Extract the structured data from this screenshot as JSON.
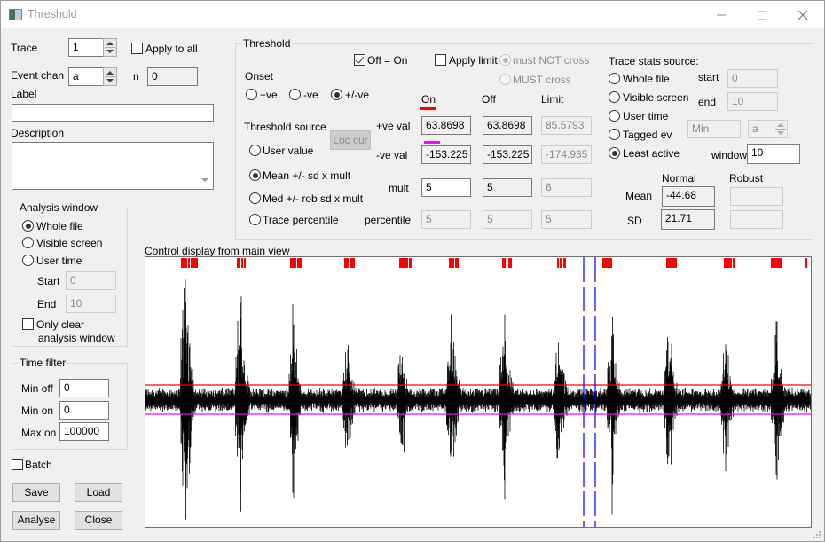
{
  "window": {
    "title": "Threshold",
    "controls": {
      "minimize": "minimize-icon",
      "maximize": "maximize-icon",
      "close": "close-icon"
    }
  },
  "left": {
    "trace_label": "Trace",
    "trace_value": "1",
    "apply_to_all_label": "Apply to all",
    "apply_to_all_checked": false,
    "event_chan_label": "Event chan",
    "event_chan_value": "a",
    "n_label": "n",
    "n_value": "0",
    "label_label": "Label",
    "label_value": "",
    "description_label": "Description",
    "description_value": "",
    "analysis_window": {
      "title": "Analysis window",
      "options": [
        "Whole file",
        "Visible screen",
        "User time"
      ],
      "selected": "Whole file",
      "start_label": "Start",
      "start_value": "0",
      "end_label": "End",
      "end_value": "10",
      "only_clear_label_1": "Only clear",
      "only_clear_label_2": "analysis window",
      "only_clear_checked": false
    },
    "time_filter": {
      "title": "Time filter",
      "min_off_label": "Min off",
      "min_off_value": "0",
      "min_on_label": "Min on",
      "min_on_value": "0",
      "max_on_label": "Max on",
      "max_on_value": "100000"
    },
    "batch_label": "Batch",
    "batch_checked": false,
    "buttons": {
      "save": "Save",
      "load": "Load",
      "analyse": "Analyse",
      "close": "Close"
    }
  },
  "threshold": {
    "title": "Threshold",
    "off_eq_on_label": "Off = On",
    "off_eq_on_checked": true,
    "apply_limit_label": "Apply limit",
    "apply_limit_checked": false,
    "must_not_cross_label": "must NOT cross",
    "must_cross_label": "MUST cross",
    "limit_mode_selected": "must NOT cross",
    "onset_label": "Onset",
    "onset_options": [
      "+ve",
      "-ve",
      "+/-ve"
    ],
    "onset_selected": "+/-ve",
    "source_label": "Threshold source",
    "loc_cur_label": "Loc cur",
    "source_options": [
      "User value",
      "Mean +/- sd x mult",
      "Med +/- rob sd x mult",
      "Trace percentile"
    ],
    "source_selected": "Mean +/- sd x mult",
    "col_headers": {
      "on": "On",
      "off": "Off",
      "limit": "Limit"
    },
    "on_color": "#ff0000",
    "neg_color": "#ff00ff",
    "rows": {
      "pos_val": {
        "label": "+ve val",
        "on": "63.8698",
        "off": "63.8698",
        "limit": "85.5793"
      },
      "neg_val": {
        "label": "-ve val",
        "on": "-153.225",
        "off": "-153.225",
        "limit": "-174.935"
      },
      "mult": {
        "label": "mult",
        "on": "5",
        "off": "5",
        "limit": "6"
      },
      "percentile": {
        "label": "percentile",
        "on": "5",
        "off": "5",
        "limit": "5"
      }
    }
  },
  "stats": {
    "title": "Trace stats source:",
    "options": [
      "Whole file",
      "Visible screen",
      "User time",
      "Tagged ev",
      "Least active"
    ],
    "selected": "Least active",
    "start_label": "start",
    "start_value": "0",
    "end_label": "end",
    "end_value": "10",
    "min_value": "Min",
    "chan_value": "a",
    "window_label": "window",
    "window_value": "10",
    "normal_label": "Normal",
    "robust_label": "Robust",
    "mean_label": "Mean",
    "sd_label": "SD",
    "mean_normal": "-44.68",
    "sd_normal": "21.71",
    "mean_robust": "",
    "sd_robust": ""
  },
  "plot": {
    "title": "Control display from main view",
    "trace_color": "#000000",
    "pos_threshold_color": "#ff0000",
    "neg_threshold_color": "#ff00ff",
    "cursor_color": "#0000ff",
    "event_marker_color": "#ff0000",
    "burst_count": 12
  }
}
